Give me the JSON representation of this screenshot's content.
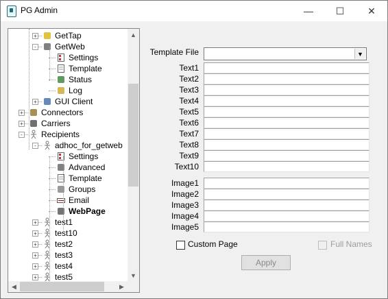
{
  "window": {
    "title": "PG Admin",
    "minimize_glyph": "—",
    "maximize_glyph": "☐",
    "close_glyph": "✕"
  },
  "tree": {
    "rows": [
      {
        "label": "GetTap",
        "level": 2,
        "expander": "+",
        "icon": "tap-icon",
        "bold": false
      },
      {
        "label": "GetWeb",
        "level": 2,
        "expander": "-",
        "icon": "web-icon",
        "bold": false
      },
      {
        "label": "Settings",
        "level": 3,
        "expander": "",
        "icon": "settings-icon",
        "bold": false
      },
      {
        "label": "Template",
        "level": 3,
        "expander": "",
        "icon": "template-icon",
        "bold": false
      },
      {
        "label": "Status",
        "level": 3,
        "expander": "",
        "icon": "status-icon",
        "bold": false
      },
      {
        "label": "Log",
        "level": 3,
        "expander": "",
        "icon": "log-icon",
        "bold": false
      },
      {
        "label": "GUI Client",
        "level": 2,
        "expander": "+",
        "icon": "gui-client-icon",
        "bold": false
      },
      {
        "label": "Connectors",
        "level": 1,
        "expander": "+",
        "icon": "connectors-icon",
        "bold": false
      },
      {
        "label": "Carriers",
        "level": 1,
        "expander": "+",
        "icon": "carriers-icon",
        "bold": false
      },
      {
        "label": "Recipients",
        "level": 1,
        "expander": "-",
        "icon": "recipients-icon",
        "bold": false
      },
      {
        "label": "adhoc_for_getweb",
        "level": 2,
        "expander": "-",
        "icon": "person-icon",
        "bold": false
      },
      {
        "label": "Settings",
        "level": 3,
        "expander": "",
        "icon": "settings-icon",
        "bold": false
      },
      {
        "label": "Advanced",
        "level": 3,
        "expander": "",
        "icon": "advanced-icon",
        "bold": false
      },
      {
        "label": "Template",
        "level": 3,
        "expander": "",
        "icon": "template-icon",
        "bold": false
      },
      {
        "label": "Groups",
        "level": 3,
        "expander": "",
        "icon": "groups-icon",
        "bold": false
      },
      {
        "label": "Email",
        "level": 3,
        "expander": "",
        "icon": "email-icon",
        "bold": false
      },
      {
        "label": "WebPage",
        "level": 3,
        "expander": "",
        "icon": "webpage-icon",
        "bold": true
      },
      {
        "label": "test1",
        "level": 2,
        "expander": "+",
        "icon": "person-icon",
        "bold": false
      },
      {
        "label": "test10",
        "level": 2,
        "expander": "+",
        "icon": "person-icon",
        "bold": false
      },
      {
        "label": "test2",
        "level": 2,
        "expander": "+",
        "icon": "person-icon",
        "bold": false
      },
      {
        "label": "test3",
        "level": 2,
        "expander": "+",
        "icon": "person-icon",
        "bold": false
      },
      {
        "label": "test4",
        "level": 2,
        "expander": "+",
        "icon": "person-icon",
        "bold": false
      },
      {
        "label": "test5",
        "level": 2,
        "expander": "+",
        "icon": "person-icon",
        "bold": false
      }
    ],
    "scroll_up": "▲",
    "scroll_down": "▼",
    "scroll_left": "◀",
    "scroll_right": "▶"
  },
  "form": {
    "template_file_label": "Template File",
    "template_file_value": "",
    "text_labels": [
      "Text1",
      "Text2",
      "Text3",
      "Text4",
      "Text5",
      "Text6",
      "Text7",
      "Text8",
      "Text9",
      "Text10"
    ],
    "text_values": [
      "",
      "",
      "",
      "",
      "",
      "",
      "",
      "",
      "",
      ""
    ],
    "image_labels": [
      "Image1",
      "Image2",
      "Image3",
      "Image4",
      "Image5"
    ],
    "image_values": [
      "",
      "",
      "",
      "",
      ""
    ],
    "custom_page_label": "Custom Page",
    "custom_page_checked": false,
    "full_names_label": "Full Names",
    "full_names_checked": false,
    "apply_label": "Apply",
    "combo_arrow": "▼"
  },
  "colors": {
    "accent": "#1b6b7a",
    "disabled_text": "#9d9d9d"
  }
}
